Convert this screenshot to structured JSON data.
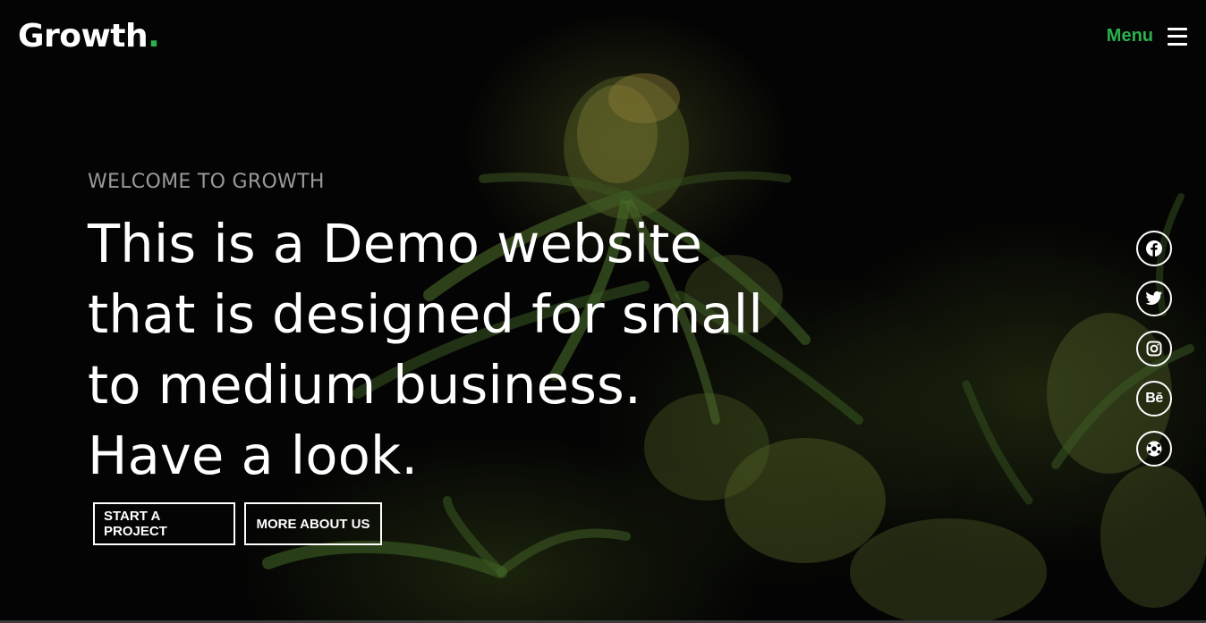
{
  "brand": {
    "name": "Growth",
    "accent_dot": ".",
    "accent_color": "#2bb24c"
  },
  "nav": {
    "menu_label": "Menu",
    "menu_icon": "hamburger-icon"
  },
  "hero": {
    "eyebrow": "WELCOME TO GROWTH",
    "headline_lines": [
      "This is a Demo website",
      "that is designed for small",
      "to medium business.",
      "Have a look."
    ],
    "background": "cannabis-plant-photo"
  },
  "buttons": {
    "start": "START A PROJECT",
    "more": "MORE ABOUT US"
  },
  "social": [
    {
      "name": "facebook",
      "icon": "facebook-icon"
    },
    {
      "name": "twitter",
      "icon": "twitter-icon"
    },
    {
      "name": "instagram",
      "icon": "instagram-icon"
    },
    {
      "name": "behance",
      "icon": "behance-icon",
      "glyph": "Bē"
    },
    {
      "name": "dribbble",
      "icon": "dribbble-icon"
    }
  ]
}
